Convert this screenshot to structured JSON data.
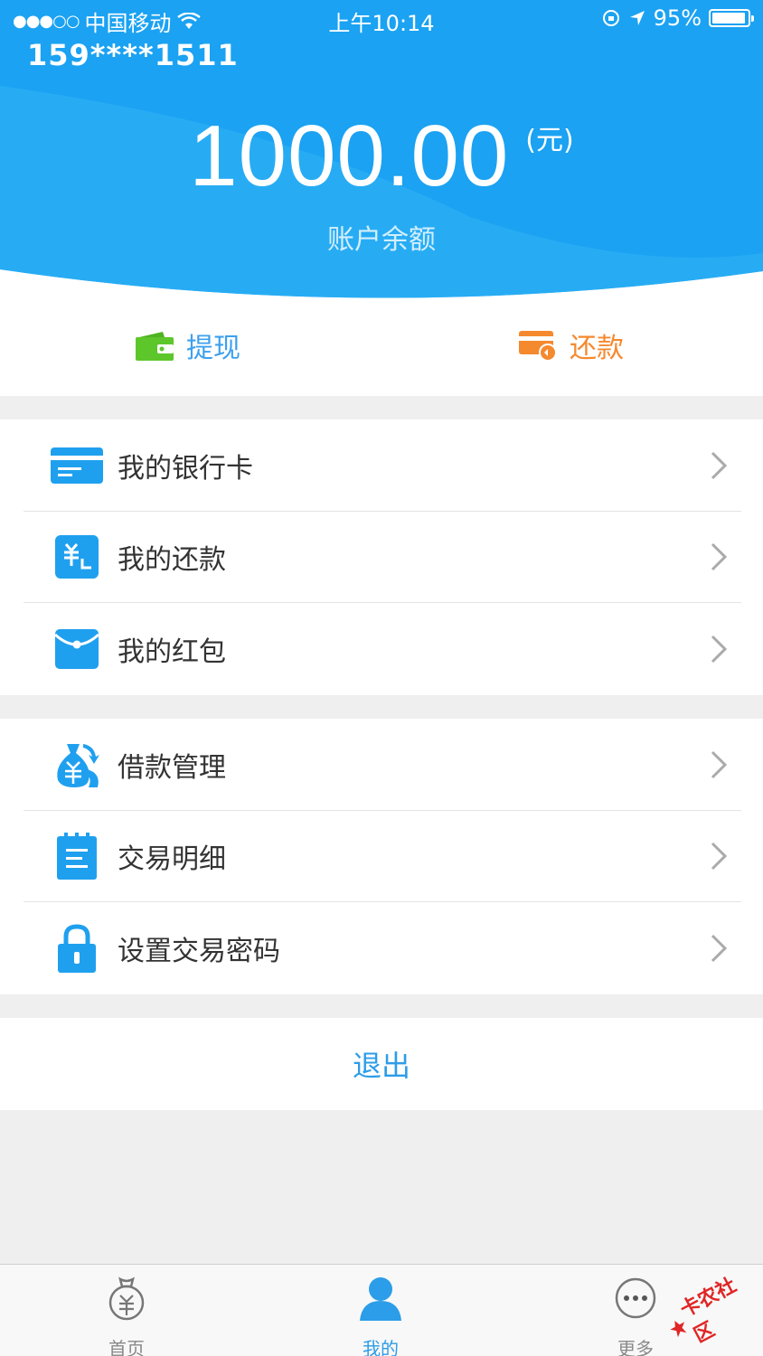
{
  "status_bar": {
    "carrier": "中国移动",
    "time": "上午10:14",
    "battery": "95%",
    "battery_level": 0.95
  },
  "header": {
    "phone": "159****1511",
    "balance": "1000.00",
    "unit": "(元)",
    "balance_label": "账户余额"
  },
  "actions": {
    "withdraw": "提现",
    "repay": "还款"
  },
  "menu_group_1": [
    {
      "label": "我的银行卡",
      "icon": "bank-card-icon"
    },
    {
      "label": "我的还款",
      "icon": "repayment-icon"
    },
    {
      "label": "我的红包",
      "icon": "red-envelope-icon"
    }
  ],
  "menu_group_2": [
    {
      "label": "借款管理",
      "icon": "money-bag-icon"
    },
    {
      "label": "交易明细",
      "icon": "notepad-icon"
    },
    {
      "label": "设置交易密码",
      "icon": "lock-icon"
    }
  ],
  "logout": "退出",
  "tabbar": {
    "home": "首页",
    "mine": "我的",
    "more": "更多"
  },
  "watermark": "卡农社区",
  "colors": {
    "header_blue": "#1a9ff0",
    "accent_blue": "#2c9de8",
    "withdraw_green": "#5dc62a",
    "repay_orange": "#f5892e"
  }
}
